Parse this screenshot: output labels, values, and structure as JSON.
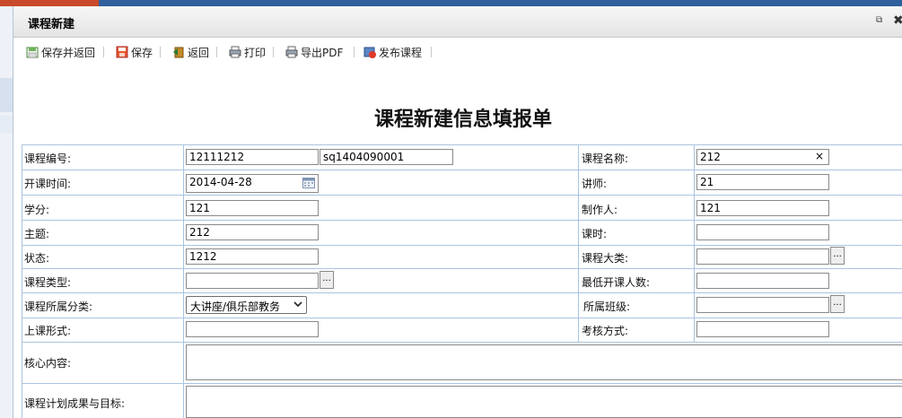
{
  "window": {
    "title": "课程新建"
  },
  "toolbar": {
    "items": [
      {
        "label": "保存并返回",
        "icon": "save-return-icon"
      },
      {
        "label": "保存",
        "icon": "save-icon"
      },
      {
        "label": "返回",
        "icon": "back-icon"
      },
      {
        "label": "打印",
        "icon": "print-icon"
      },
      {
        "label": "导出PDF",
        "icon": "export-pdf-icon"
      },
      {
        "label": "发布课程",
        "icon": "publish-icon"
      }
    ]
  },
  "form": {
    "heading": "课程新建信息填报单",
    "course_no_label": "课程编号:",
    "course_no_value": "12111212",
    "course_no_value2": "sq1404090001",
    "course_name_label": "课程名称:",
    "course_name_value": "212",
    "start_time_label": "开课时间:",
    "start_time_value": "2014-04-28",
    "lecturer_label": "讲师:",
    "lecturer_value": "21",
    "credit_label": "学分:",
    "credit_value": "121",
    "maker_label": "制作人:",
    "maker_value": "121",
    "topic_label": "主题:",
    "topic_value": "212",
    "hours_label": "课时:",
    "hours_value": "",
    "status_label": "状态:",
    "status_value": "1212",
    "category_label": "课程大类:",
    "category_value": "",
    "type_label": "课程类型:",
    "type_value": "",
    "min_people_label": "最低开课人数:",
    "min_people_value": "",
    "class_category_label": "课程所属分类:",
    "class_category_value": "大讲座/俱乐部教务",
    "class_label": "所属班级:",
    "class_value": "",
    "mode_label": "上课形式:",
    "mode_value": "",
    "exam_label": "考核方式:",
    "exam_value": "",
    "core_label": "核心内容:",
    "plan_label": "课程计划成果与目标:"
  },
  "glyphs": {
    "clear": "×",
    "more": "...",
    "restore": "⧉",
    "close": "✖"
  }
}
